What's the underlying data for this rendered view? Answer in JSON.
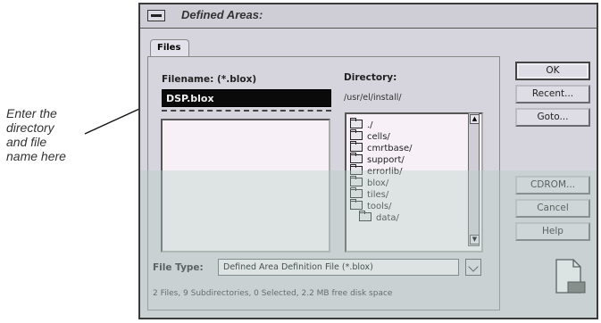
{
  "annotation": {
    "lines": [
      "Enter the",
      "directory",
      "and file",
      "name here"
    ]
  },
  "dialog": {
    "title": "Defined Areas:",
    "tab_label": "Files",
    "filename_label": "Filename: (*.blox)",
    "filename_value": "DSP.blox",
    "directory_label": "Directory:",
    "directory_path": "/usr/el/install/",
    "directories": [
      "./",
      "cells/",
      "cmrtbase/",
      "support/",
      "errorlib/",
      "blox/",
      "tiles/",
      "tools/",
      "data/"
    ],
    "filetype_label": "File Type:",
    "filetype_value": "Defined Area Definition File (*.blox)",
    "status_text": "2 Files, 9 Subdirectories, 0 Selected, 2.2 MB free disk space",
    "buttons": {
      "ok": "OK",
      "recent": "Recent...",
      "goto": "Goto...",
      "cdrom": "CDROM...",
      "cancel": "Cancel",
      "help": "Help"
    }
  },
  "colors": {
    "dialog_bg": "#d6d4dc",
    "list_bg": "#f7f1f7",
    "shade": "#b6cdc6"
  }
}
